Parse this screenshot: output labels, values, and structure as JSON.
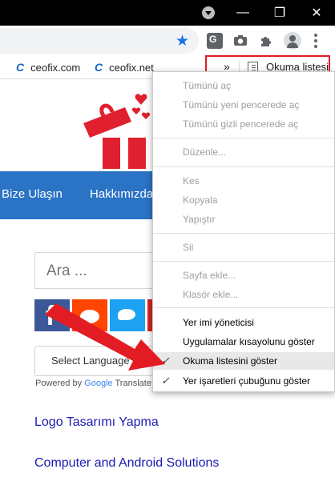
{
  "window": {
    "minimize": "—",
    "maximize": "❐",
    "close": "✕"
  },
  "toolbar": {
    "bookmark_star": "★"
  },
  "bookmarks": {
    "items": [
      {
        "label": "ceofix.com"
      },
      {
        "label": "ceofix.net"
      }
    ],
    "overflow": "»",
    "reading_list": "Okuma listesi"
  },
  "page": {
    "nav": [
      "Bize Ulaşın",
      "Hakkımızda"
    ],
    "search_placeholder": "Ara ...",
    "language_select": "Select Language",
    "powered_by": "Powered by",
    "google": "Google",
    "translate": "Translate",
    "links": [
      "Logo Tasarımı Yapma",
      "Computer and Android Solutions"
    ]
  },
  "menu": {
    "groups": [
      [
        "Tümünü aç",
        "Tümünü yeni pencerede aç",
        "Tümünü gizli pencerede aç"
      ],
      [
        "Düzenle..."
      ],
      [
        "Kes",
        "Kopyala",
        "Yapıştır"
      ],
      [
        "Sil"
      ],
      [
        "Sayfa ekle...",
        "Klasör ekle..."
      ],
      [
        "Yer imi yöneticisi",
        "Uygulamalar kısayolunu göster",
        "Okuma listesini göster",
        "Yer işaretleri çubuğunu göster"
      ]
    ],
    "checked_items": [
      "Okuma listesini göster",
      "Yer işaretleri çubuğunu göster"
    ],
    "highlighted_item": "Okuma listesini göster"
  },
  "colors": {
    "highlight_box": "#e31b23",
    "nav_blue": "#2a73c5",
    "link": "#1a1ab5"
  }
}
